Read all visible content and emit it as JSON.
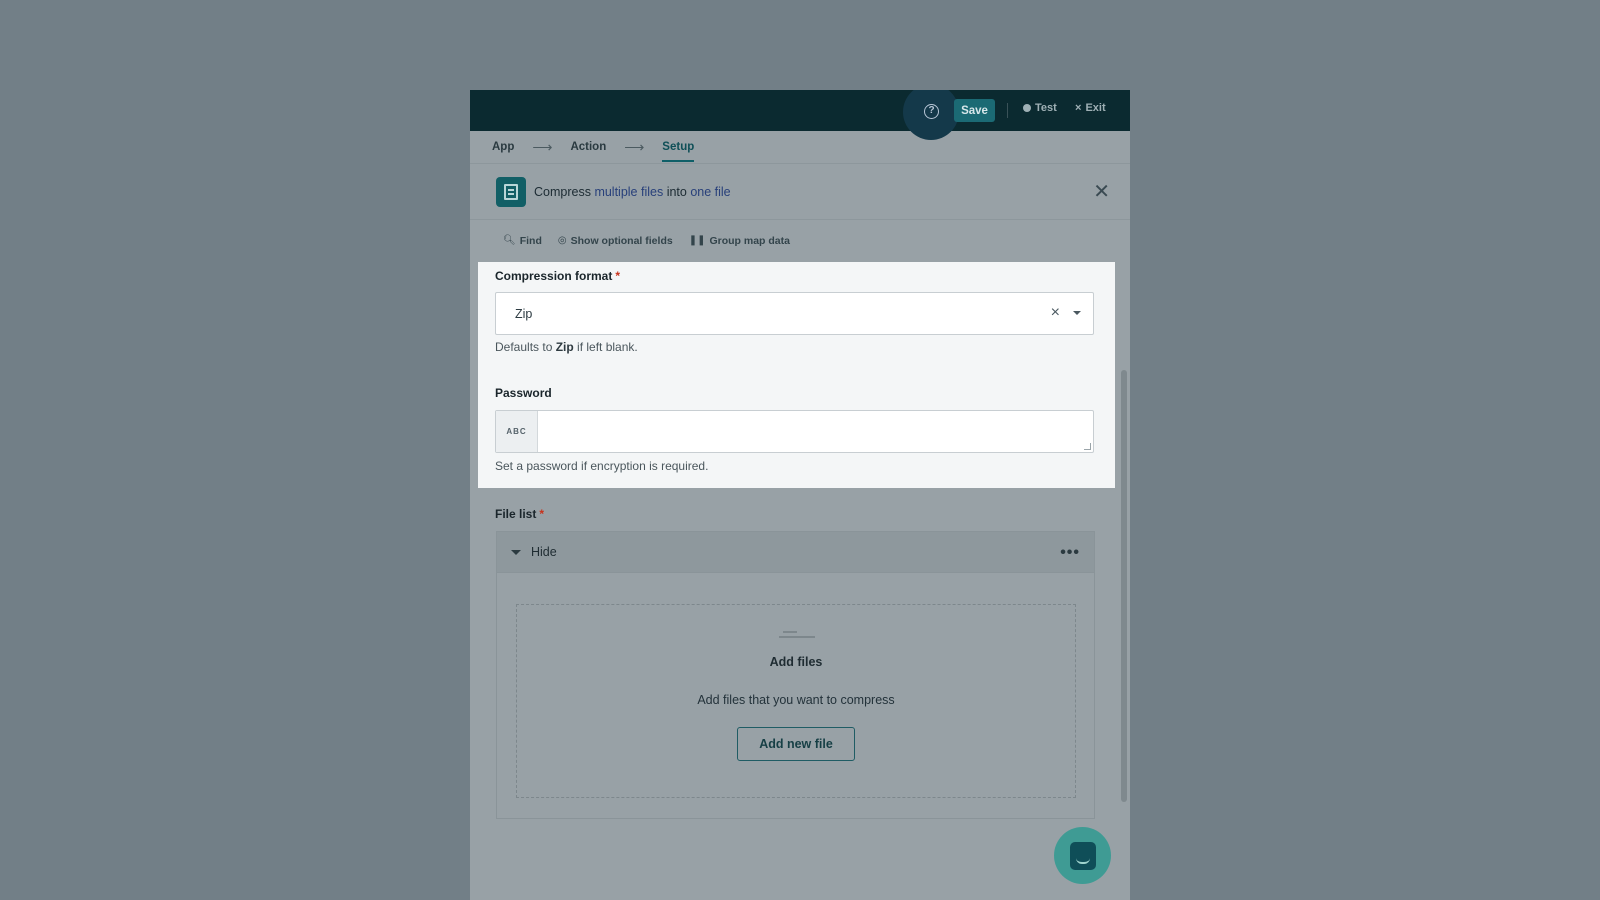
{
  "topbar": {
    "save_label": "Save",
    "test_label": "Test",
    "exit_label": "Exit",
    "help_glyph": "?",
    "exit_glyph": "×"
  },
  "breadcrumb": {
    "items": [
      "App",
      "Action",
      "Setup"
    ],
    "active": "Setup",
    "separator": "⟶"
  },
  "header": {
    "prefix": "Compress ",
    "link1": "multiple files",
    "middle": " into ",
    "link2": "one file",
    "close_glyph": "✕"
  },
  "toolbar": {
    "find_label": "Find",
    "show_optional_label": "Show optional fields",
    "group_map_label": "Group map data"
  },
  "form": {
    "compression_format": {
      "label": "Compression format",
      "required_mark": "*",
      "value": "Zip",
      "clear_glyph": "×",
      "hint_prefix": "Defaults to ",
      "hint_bold": "Zip",
      "hint_suffix": " if left blank."
    },
    "password": {
      "label": "Password",
      "badge": "ABC",
      "value": "",
      "hint": "Set a password if encryption is required."
    },
    "file_list": {
      "label": "File list",
      "required_mark": "*",
      "toggle_label": "Hide",
      "more_glyph": "•••",
      "empty_title": "Add files",
      "empty_subtitle": "Add files that you want to compress",
      "add_button_label": "Add new file"
    }
  },
  "colors": {
    "topbar_bg": "#0b2a30",
    "accent": "#1b6a74",
    "required": "#c8321c",
    "link": "#28407a",
    "chat_button": "#3f9b94"
  },
  "icons": {
    "help": "help-circle-icon",
    "test": "gear-icon",
    "exit": "close-icon",
    "find": "search-icon",
    "show_optional": "eye-icon",
    "group_map": "columns-icon",
    "app": "document-stack-icon",
    "chat": "chat-icon"
  }
}
